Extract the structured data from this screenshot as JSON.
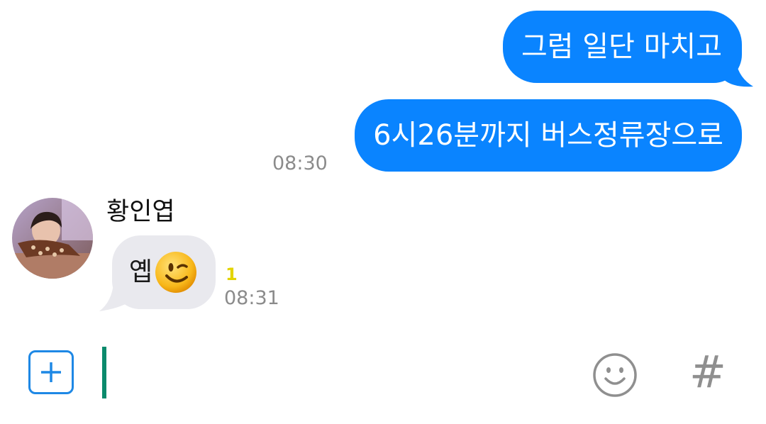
{
  "messages": [
    {
      "direction": "outgoing",
      "text": "그럼 일단 마치고"
    },
    {
      "direction": "outgoing",
      "text": "6시26분까지 버스정류장으로",
      "time": "08:30"
    },
    {
      "direction": "incoming",
      "sender": "황인엽",
      "text": "옙",
      "emoji": "wink-emoji",
      "unread": "1",
      "time": "08:31"
    }
  ],
  "input": {
    "value": "",
    "placeholder": ""
  },
  "toolbar": {
    "plus_icon": "plus-square-icon",
    "emoji_icon": "smiley-icon",
    "hashtag_label": "#"
  },
  "colors": {
    "outgoing_bubble": "#0a84ff",
    "incoming_bubble": "#e9e9ee",
    "accent": "#1e88e5",
    "cursor": "#0a8a6c",
    "unread": "#e3d400",
    "timestamp": "#8b8b8b"
  }
}
